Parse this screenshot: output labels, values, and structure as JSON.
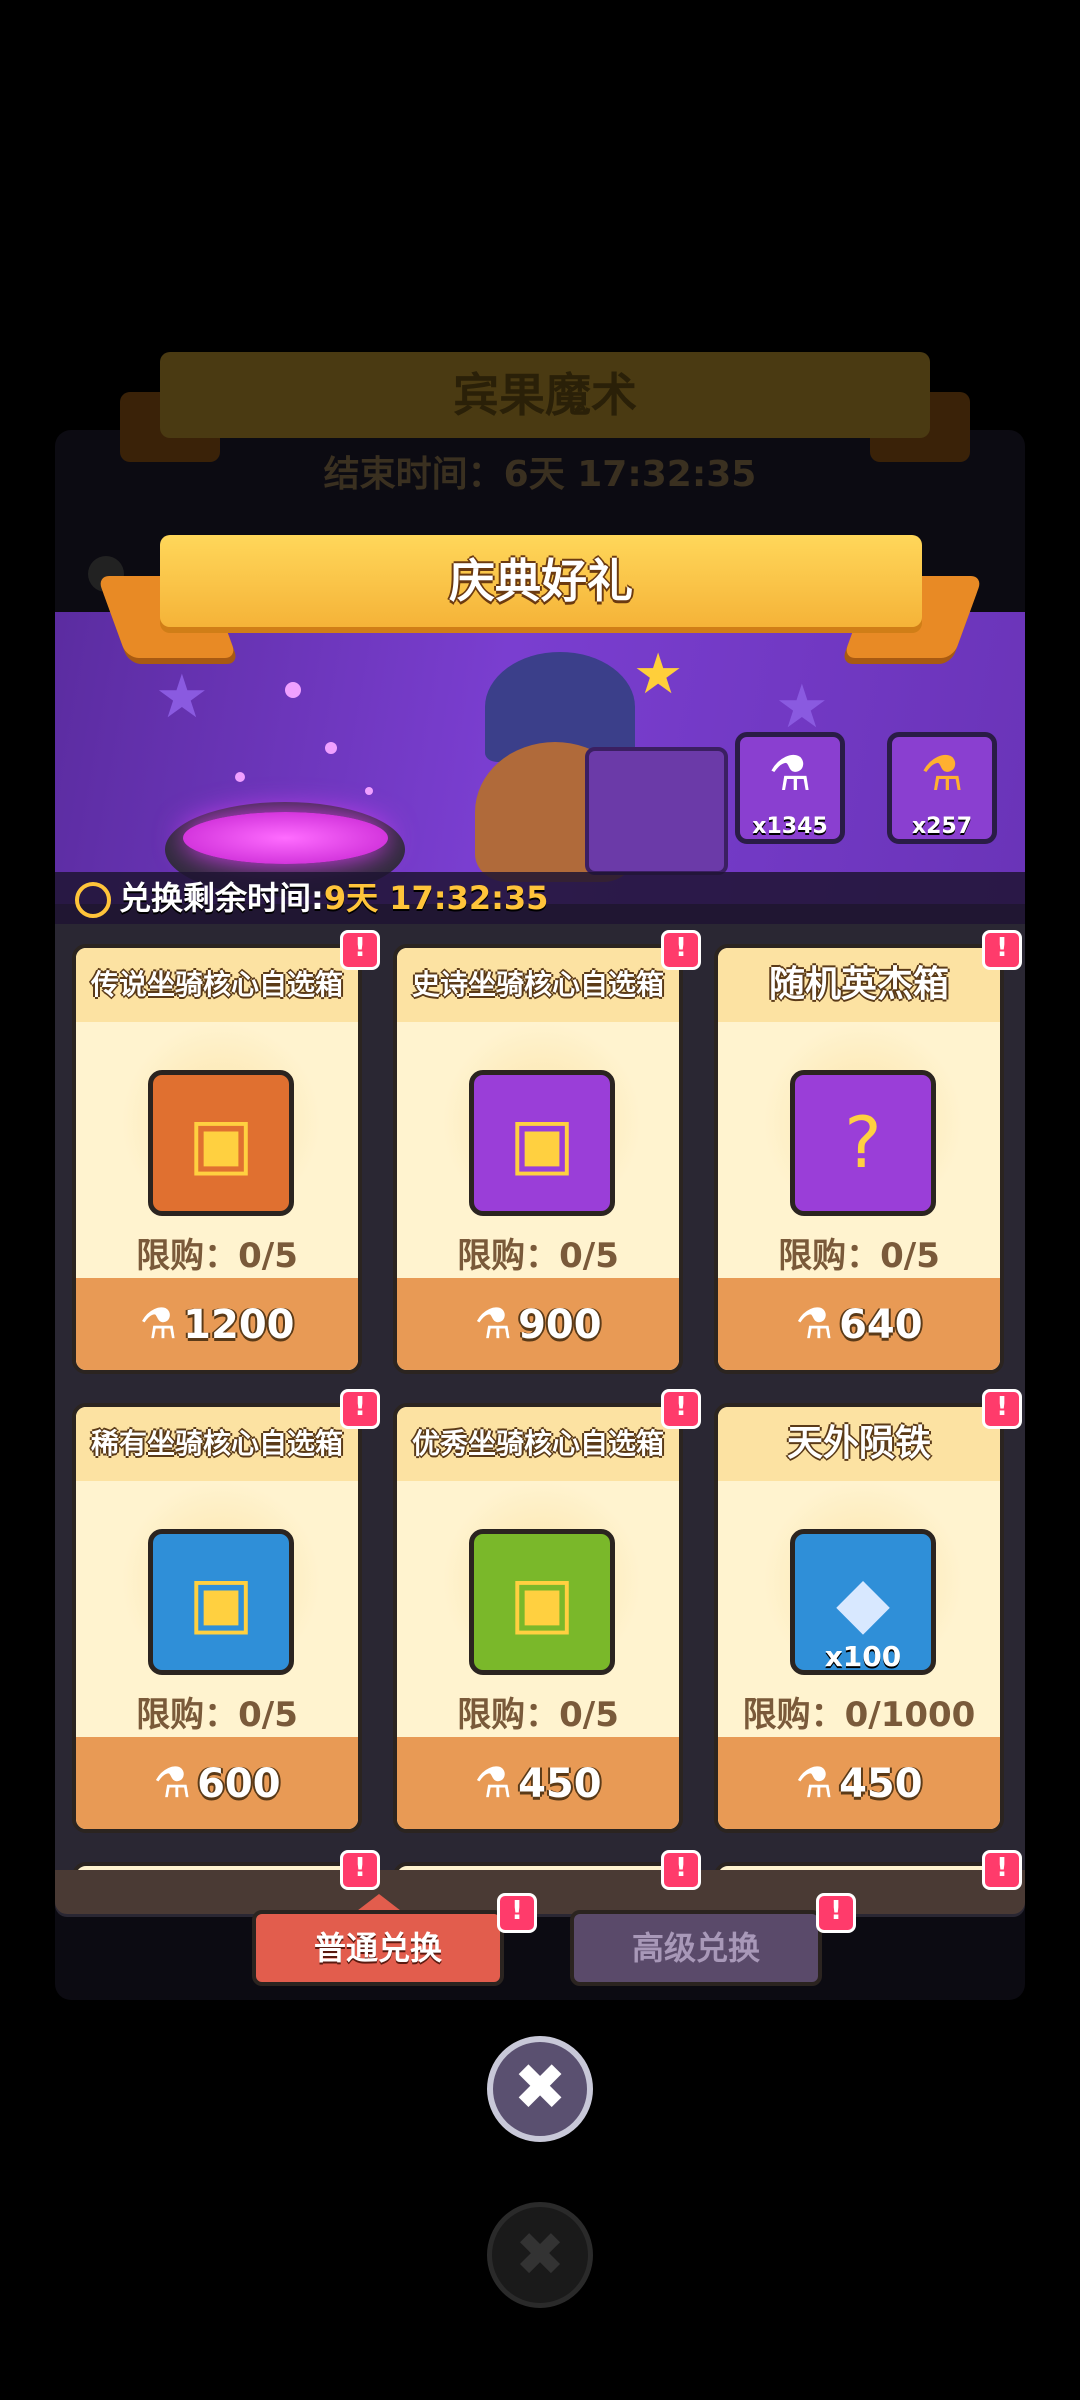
{
  "background": {
    "event_title": "宾果魔术",
    "end_time_label": "结束时间：",
    "end_time_value": "6天 17:32:35"
  },
  "header": {
    "title": "庆典好礼"
  },
  "currencies": [
    {
      "icon": "purple-potion-icon",
      "count": "x1345"
    },
    {
      "icon": "orange-potion-icon",
      "count": "x257"
    }
  ],
  "timer": {
    "label": "兑换剩余时间:",
    "value": "9天 17:32:35"
  },
  "items": [
    {
      "name": "传说坐骑核心自选箱",
      "icon": "legendary-chest-icon",
      "color": "#e07030",
      "limit": "限购：0/5",
      "price": "1200"
    },
    {
      "name": "史诗坐骑核心自选箱",
      "icon": "epic-chest-icon",
      "color": "#9a3ed8",
      "limit": "限购：0/5",
      "price": "900"
    },
    {
      "name": "随机英杰箱",
      "icon": "mystery-hero-chest-icon",
      "color": "#9a3ed8",
      "limit": "限购：0/5",
      "price": "640"
    },
    {
      "name": "稀有坐骑核心自选箱",
      "icon": "rare-chest-icon",
      "color": "#2f8fd8",
      "limit": "限购：0/5",
      "price": "600"
    },
    {
      "name": "优秀坐骑核心自选箱",
      "icon": "uncommon-chest-icon",
      "color": "#7ab82a",
      "limit": "限购：0/5",
      "price": "450"
    },
    {
      "name": "天外陨铁",
      "icon": "meteorite-crystal-icon",
      "color": "#2f8fd8",
      "qty": "x100",
      "limit": "限购：0/1000",
      "price": "450"
    }
  ],
  "badge": "!",
  "tabs": {
    "normal": "普通兑换",
    "advanced": "高级兑换"
  },
  "close_glyph": "✖"
}
